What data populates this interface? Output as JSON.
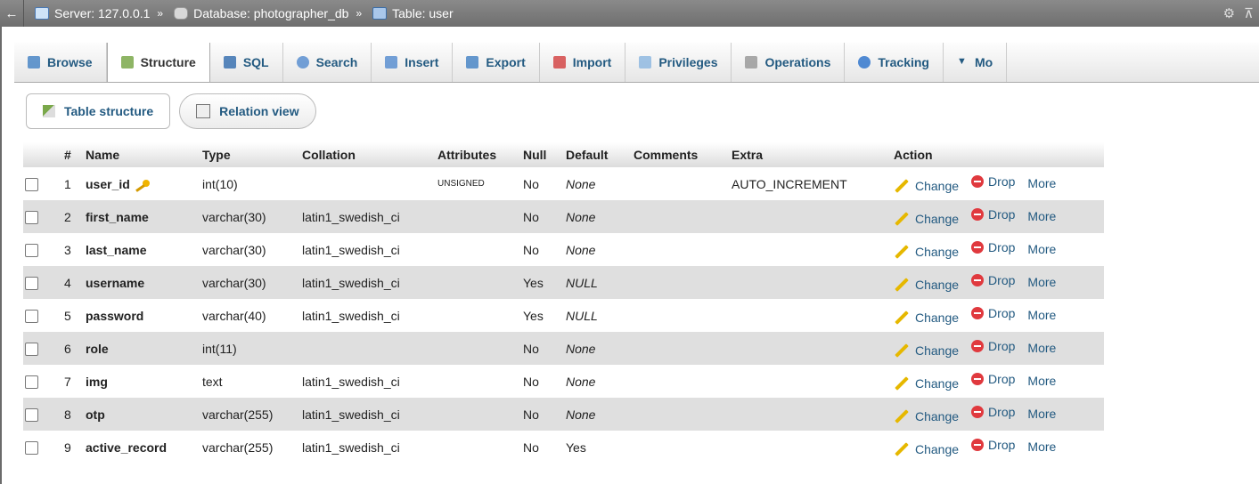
{
  "breadcrumb": {
    "back": "←",
    "server": "Server: 127.0.0.1",
    "database": "Database: photographer_db",
    "table": "Table: user",
    "separator": "»"
  },
  "tabs": [
    {
      "label": "Browse",
      "icon": "browse-icon"
    },
    {
      "label": "Structure",
      "icon": "structure-icon"
    },
    {
      "label": "SQL",
      "icon": "sql-icon"
    },
    {
      "label": "Search",
      "icon": "search-icon"
    },
    {
      "label": "Insert",
      "icon": "insert-icon"
    },
    {
      "label": "Export",
      "icon": "export-icon"
    },
    {
      "label": "Import",
      "icon": "import-icon"
    },
    {
      "label": "Privileges",
      "icon": "privileges-icon"
    },
    {
      "label": "Operations",
      "icon": "operations-icon"
    },
    {
      "label": "Tracking",
      "icon": "tracking-icon"
    },
    {
      "label": "Mo",
      "icon": "more-chevron-icon"
    }
  ],
  "subtabs": {
    "table_structure": "Table structure",
    "relation_view": "Relation view"
  },
  "columns": [
    "#",
    "Name",
    "Type",
    "Collation",
    "Attributes",
    "Null",
    "Default",
    "Comments",
    "Extra",
    "Action"
  ],
  "actions": {
    "change": "Change",
    "drop": "Drop",
    "more": "More"
  },
  "rows": [
    {
      "num": "1",
      "name": "user_id",
      "type": "int(10)",
      "collation": "",
      "attributes": "UNSIGNED",
      "null": "No",
      "default": "None",
      "comments": "",
      "extra": "AUTO_INCREMENT"
    },
    {
      "num": "2",
      "name": "first_name",
      "type": "varchar(30)",
      "collation": "latin1_swedish_ci",
      "attributes": "",
      "null": "No",
      "default": "None",
      "comments": "",
      "extra": ""
    },
    {
      "num": "3",
      "name": "last_name",
      "type": "varchar(30)",
      "collation": "latin1_swedish_ci",
      "attributes": "",
      "null": "No",
      "default": "None",
      "comments": "",
      "extra": ""
    },
    {
      "num": "4",
      "name": "username",
      "type": "varchar(30)",
      "collation": "latin1_swedish_ci",
      "attributes": "",
      "null": "Yes",
      "default": "NULL",
      "comments": "",
      "extra": ""
    },
    {
      "num": "5",
      "name": "password",
      "type": "varchar(40)",
      "collation": "latin1_swedish_ci",
      "attributes": "",
      "null": "Yes",
      "default": "NULL",
      "comments": "",
      "extra": ""
    },
    {
      "num": "6",
      "name": "role",
      "type": "int(11)",
      "collation": "",
      "attributes": "",
      "null": "No",
      "default": "None",
      "comments": "",
      "extra": ""
    },
    {
      "num": "7",
      "name": "img",
      "type": "text",
      "collation": "latin1_swedish_ci",
      "attributes": "",
      "null": "No",
      "default": "None",
      "comments": "",
      "extra": ""
    },
    {
      "num": "8",
      "name": "otp",
      "type": "varchar(255)",
      "collation": "latin1_swedish_ci",
      "attributes": "",
      "null": "No",
      "default": "None",
      "comments": "",
      "extra": ""
    },
    {
      "num": "9",
      "name": "active_record",
      "type": "varchar(255)",
      "collation": "latin1_swedish_ci",
      "attributes": "",
      "null": "No",
      "default": "Yes",
      "comments": "",
      "extra": ""
    }
  ]
}
